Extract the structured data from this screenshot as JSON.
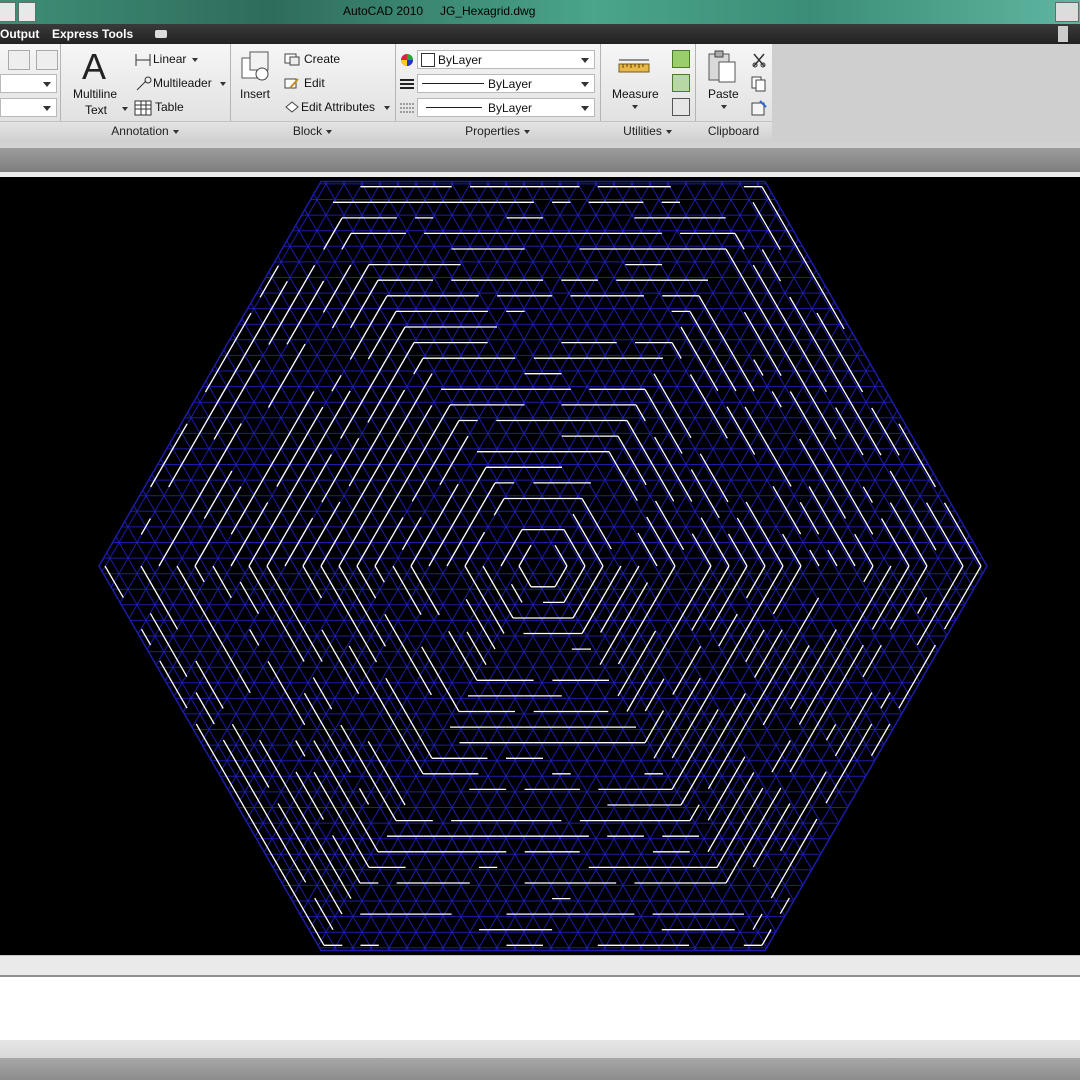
{
  "window": {
    "app_title": "AutoCAD 2010",
    "file_name": "JG_Hexagrid.dwg"
  },
  "ribbon_tabs": [
    "Output",
    "Express Tools"
  ],
  "annotation": {
    "multiline_text_line1": "Multiline",
    "multiline_text_line2": "Text",
    "linear": "Linear",
    "multileader": "Multileader",
    "table": "Table",
    "panel_label": "Annotation"
  },
  "block": {
    "insert": "Insert",
    "create": "Create",
    "edit": "Edit",
    "edit_attributes": "Edit Attributes",
    "panel_label": "Block"
  },
  "properties": {
    "color": "ByLayer",
    "linetype": "ByLayer",
    "lineweight": "ByLayer",
    "panel_label": "Properties"
  },
  "utilities": {
    "measure": "Measure",
    "panel_label": "Utilities"
  },
  "clipboard": {
    "paste": "Paste",
    "panel_label": "Clipboard"
  },
  "colors": {
    "canvas_bg": "#000000",
    "maze_line": "#ffffff",
    "grid_line": "#1c1ca8"
  }
}
